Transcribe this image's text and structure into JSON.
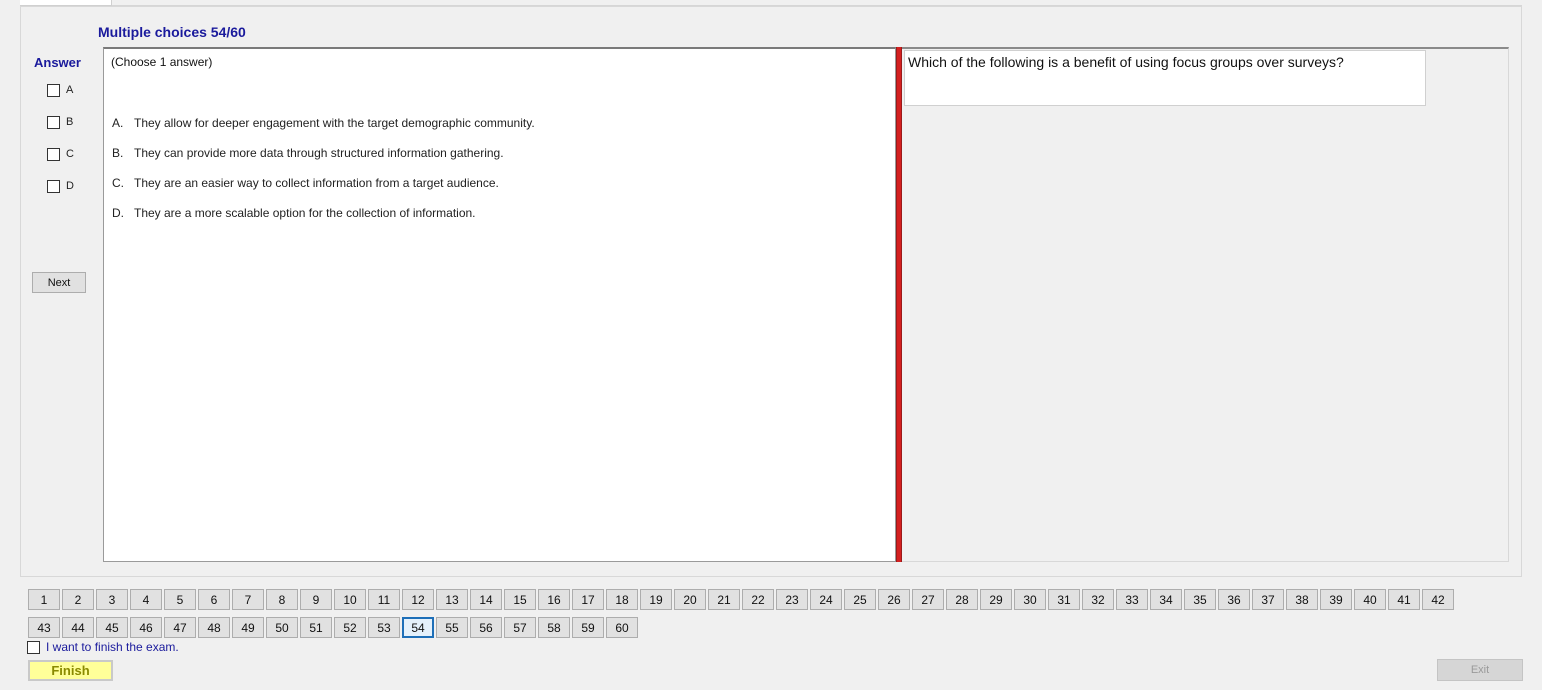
{
  "header": {
    "title": "Multiple choices 54/60"
  },
  "answer_panel": {
    "title": "Answer",
    "options": [
      {
        "letter": "A",
        "checked": false
      },
      {
        "letter": "B",
        "checked": false
      },
      {
        "letter": "C",
        "checked": false
      },
      {
        "letter": "D",
        "checked": false
      }
    ],
    "next_label": "Next"
  },
  "choices": {
    "hint": "(Choose 1 answer)",
    "items": [
      {
        "letter": "A.",
        "text": "They allow for deeper engagement with the target demographic community."
      },
      {
        "letter": "B.",
        "text": "They can provide more data through structured information gathering."
      },
      {
        "letter": "C.",
        "text": "They are an easier way to collect information from a target audience."
      },
      {
        "letter": "D.",
        "text": "They are a more scalable option for the collection of information."
      }
    ]
  },
  "question": {
    "text": "Which of the following is a benefit of using focus groups over surveys?"
  },
  "navigation": {
    "current": "54",
    "row1": [
      "1",
      "2",
      "3",
      "4",
      "5",
      "6",
      "7",
      "8",
      "9",
      "10",
      "11",
      "12",
      "13",
      "14",
      "15",
      "16",
      "17",
      "18",
      "19",
      "20",
      "21",
      "22",
      "23",
      "24",
      "25",
      "26",
      "27",
      "28",
      "29",
      "30",
      "31",
      "32",
      "33",
      "34",
      "35",
      "36",
      "37",
      "38",
      "39",
      "40",
      "41",
      "42"
    ],
    "row2": [
      "43",
      "44",
      "45",
      "46",
      "47",
      "48",
      "49",
      "50",
      "51",
      "52",
      "53",
      "54",
      "55",
      "56",
      "57",
      "58",
      "59",
      "60"
    ]
  },
  "footer": {
    "finish_checkbox_label": "I want to finish the exam.",
    "finish_label": "Finish",
    "exit_label": "Exit"
  },
  "colors": {
    "accent_text": "#1a1a9c",
    "divider_red": "#d42020",
    "finish_bg": "#ffff99",
    "current_border": "#1e6fb8"
  }
}
